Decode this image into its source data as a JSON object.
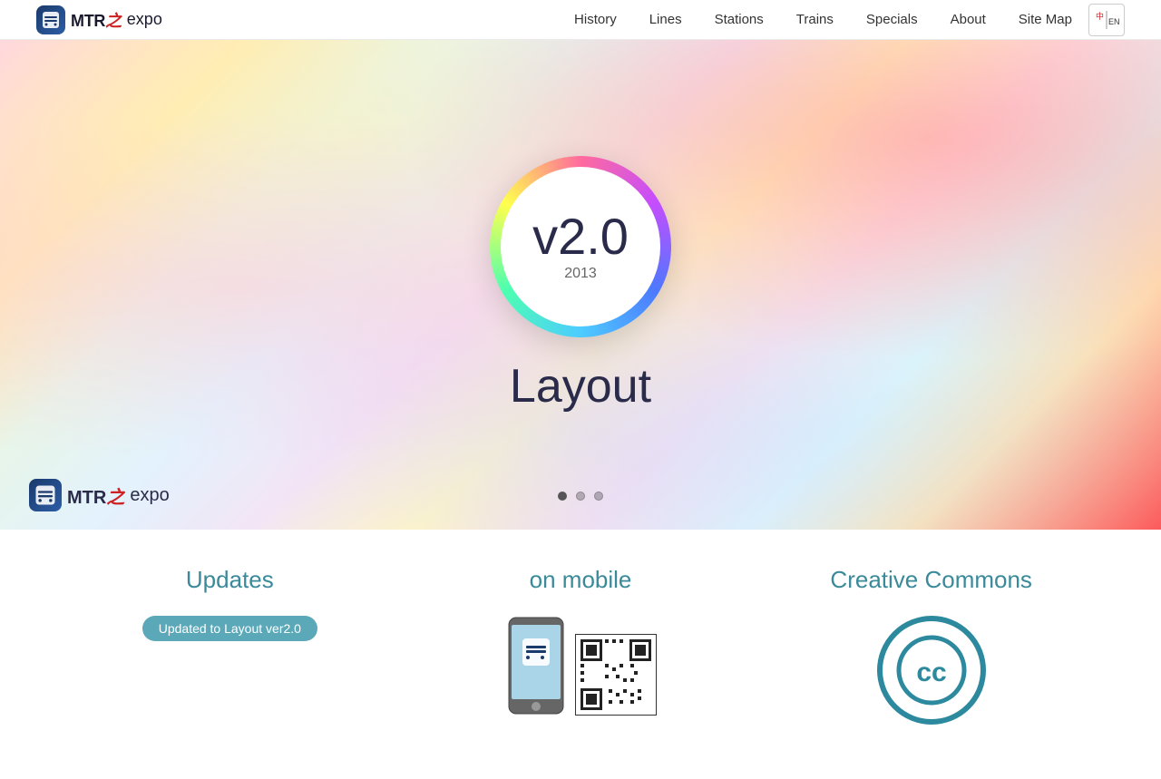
{
  "brand": {
    "logo_mtr": "MTR",
    "logo_zh": "之",
    "logo_expo": "expo",
    "alt": "MTR expo logo"
  },
  "nav": {
    "items": [
      {
        "label": "History",
        "id": "history"
      },
      {
        "label": "Lines",
        "id": "lines"
      },
      {
        "label": "Stations",
        "id": "stations"
      },
      {
        "label": "Trains",
        "id": "trains"
      },
      {
        "label": "Specials",
        "id": "specials"
      },
      {
        "label": "About",
        "id": "about"
      },
      {
        "label": "Site Map",
        "id": "sitemap"
      }
    ],
    "lang_toggle": "中\nEN"
  },
  "hero": {
    "version": "v2.0",
    "year": "2013",
    "title": "Layout",
    "dots": [
      {
        "active": true
      },
      {
        "active": false
      },
      {
        "active": false
      }
    ]
  },
  "sections": {
    "updates": {
      "title": "Updates",
      "badge": "Updated to Layout ver2.0"
    },
    "mobile": {
      "title": "on mobile"
    },
    "creative_commons": {
      "title": "Creative Commons",
      "symbol": "cc"
    }
  }
}
